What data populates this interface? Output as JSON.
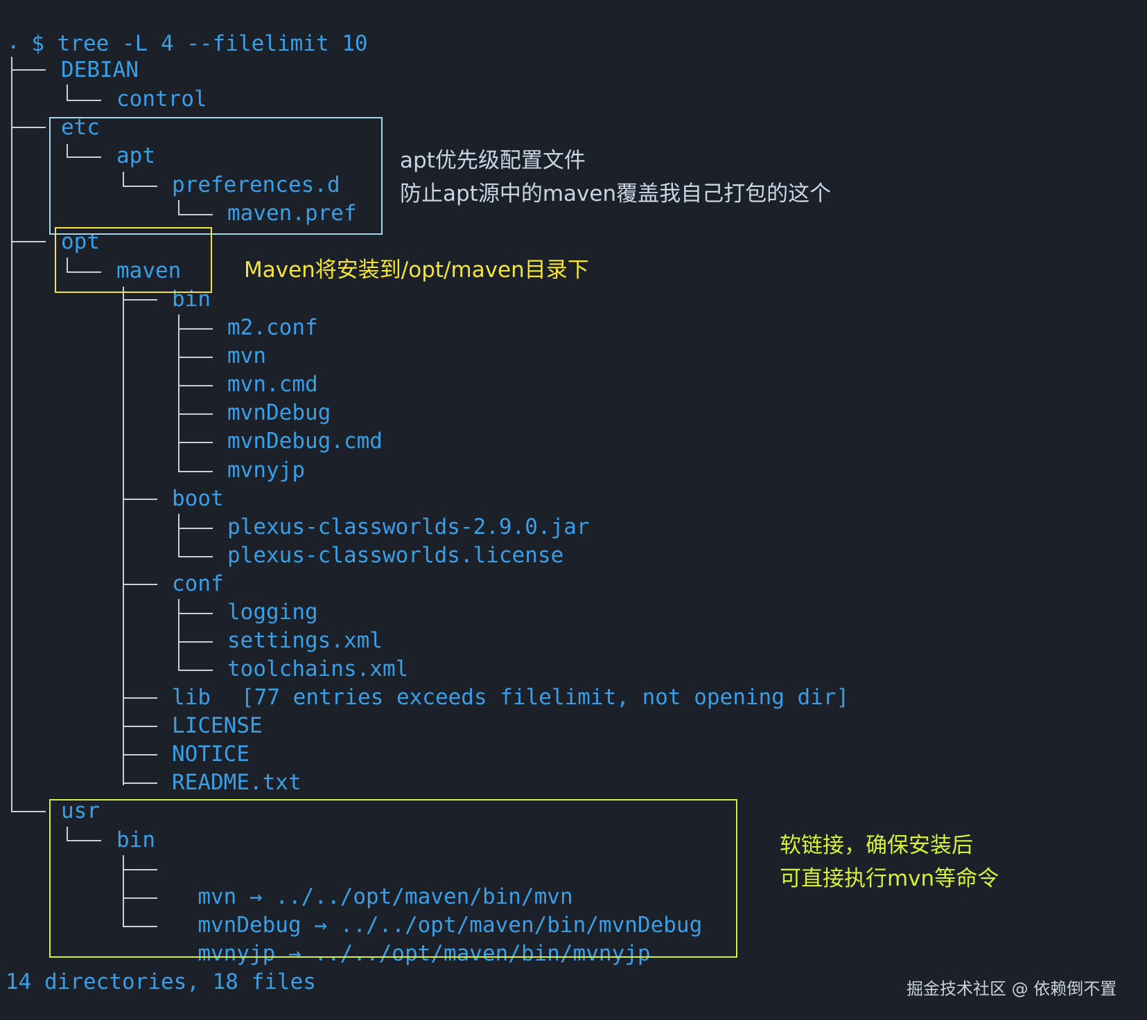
{
  "command": {
    "prompt": "$",
    "text": "tree -L 4 --filelimit 10"
  },
  "root": ".",
  "tree": {
    "debian": "DEBIAN",
    "control": "control",
    "etc": "etc",
    "apt": "apt",
    "preferences_d": "preferences.d",
    "maven_pref": "maven.pref",
    "opt": "opt",
    "maven": "maven",
    "bin": "bin",
    "m2_conf": "m2.conf",
    "mvn": "mvn",
    "mvn_cmd": "mvn.cmd",
    "mvnDebug": "mvnDebug",
    "mvnDebug_cmd": "mvnDebug.cmd",
    "mvnyjp": "mvnyjp",
    "boot": "boot",
    "plexus_jar": "plexus-classworlds-2.9.0.jar",
    "plexus_license": "plexus-classworlds.license",
    "conf": "conf",
    "logging": "logging",
    "settings_xml": "settings.xml",
    "toolchains_xml": "toolchains.xml",
    "lib": "lib",
    "lib_note": "[77 entries exceeds filelimit, not opening dir]",
    "license": "LICENSE",
    "notice": "NOTICE",
    "readme": "README.txt",
    "usr": "usr",
    "usr_bin": "bin",
    "link_mvn": "mvn",
    "link_mvn_target": "../../opt/maven/bin/mvn",
    "link_mvnDebug": "mvnDebug",
    "link_mvnDebug_target": "../../opt/maven/bin/mvnDebug",
    "link_mvnyjp": "mvnyjp",
    "link_mvnyjp_target": "../../opt/maven/bin/mvnyjp",
    "arrow": "→"
  },
  "summary": "14 directories, 18 files",
  "annotations": {
    "etc_note_line1": "apt优先级配置文件",
    "etc_note_line2": "防止apt源中的maven覆盖我自己打包的这个",
    "opt_note": "Maven将安装到/opt/maven目录下",
    "usr_note_line1": "软链接，确保安装后",
    "usr_note_line2": "可直接执行mvn等命令"
  },
  "footer": "掘金技术社区 @ 依赖倒不置",
  "colors": {
    "background": "#1b2029",
    "text": "#3a9fe6",
    "etc_box": "#a8d8f0",
    "opt_box": "#f5e53b",
    "usr_box": "#d8f03a",
    "etc_note": "#c9d6e3",
    "opt_note": "#f5e53b",
    "usr_note": "#d8f03a"
  }
}
